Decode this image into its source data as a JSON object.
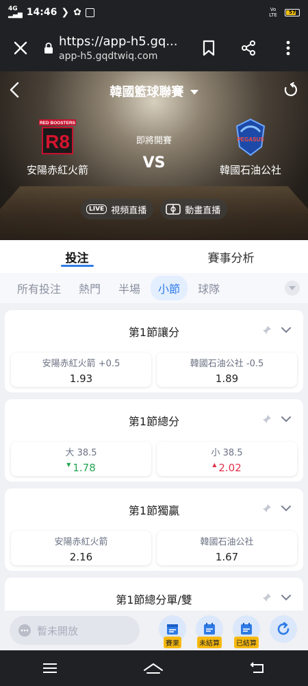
{
  "status_bar": {
    "net": "4G",
    "time": "14:46",
    "lte_label": "Vo LTE",
    "battery": "57"
  },
  "browser": {
    "url": "https://app-h5.gq...",
    "domain": "app-h5.gqdtwiq.com"
  },
  "match": {
    "league": "韓國籃球聯賽",
    "home_team": "安陽赤紅火箭",
    "away_team": "韓國石油公社",
    "status": "即將開賽",
    "vs": "VS",
    "video_live": "視頻直播",
    "anim_live": "動畫直播",
    "live_badge": "LIVE",
    "home_logo_text": "RED BOOSTERS",
    "home_logo_mark": "R8",
    "away_logo_text": "PEGASUS"
  },
  "main_tabs": [
    "投注",
    "賽事分析"
  ],
  "sub_tabs": [
    "所有投注",
    "熱門",
    "半場",
    "小節",
    "球隊"
  ],
  "markets": [
    {
      "title": "第1節讓分",
      "options": [
        {
          "label": "安陽赤紅火箭 +0.5",
          "odds": "1.93",
          "trend": ""
        },
        {
          "label": "韓國石油公社 -0.5",
          "odds": "1.89",
          "trend": ""
        }
      ]
    },
    {
      "title": "第1節總分",
      "options": [
        {
          "label": "大 38.5",
          "odds": "1.78",
          "trend": "down"
        },
        {
          "label": "小 38.5",
          "odds": "2.02",
          "trend": "up"
        }
      ]
    },
    {
      "title": "第1節獨贏",
      "options": [
        {
          "label": "安陽赤紅火箭",
          "odds": "2.16",
          "trend": ""
        },
        {
          "label": "韓國石油公社",
          "odds": "1.67",
          "trend": ""
        }
      ]
    },
    {
      "title": "第1節總分單/雙",
      "options": []
    }
  ],
  "bottom": {
    "chat_placeholder": "暫未開放",
    "buttons": [
      {
        "label": "賽果"
      },
      {
        "label": "未結算"
      },
      {
        "label": "已結算"
      }
    ]
  },
  "colors": {
    "accent": "#2f7be6",
    "up": "#e2314a",
    "down": "#23a651",
    "tag": "#f6b90f"
  }
}
